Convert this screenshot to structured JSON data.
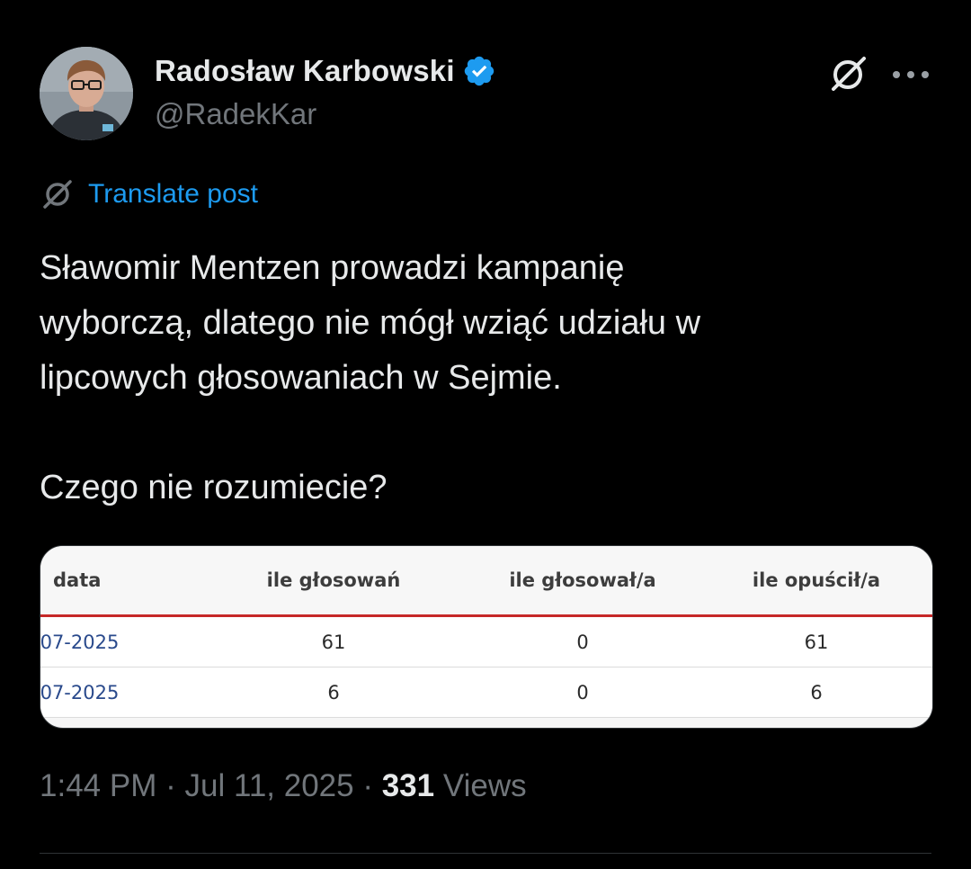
{
  "author": {
    "display_name": "Radosław Karbowski",
    "handle": "@RadekKar",
    "verified_badge_color": "#1d9bf0"
  },
  "actions": {
    "grok_icon": "grok-icon",
    "more_icon": "more-options-icon"
  },
  "translate": {
    "label": "Translate post",
    "color": "#1d9bf0"
  },
  "post": {
    "line1": "Sławomir Mentzen prowadzi kampanię",
    "line2": "wyborczą, dlatego nie mógł wziąć udziału w",
    "line3": "lipcowych głosowaniach w Sejmie.",
    "line4": "Czego nie rozumiecie?"
  },
  "media_table": {
    "headers": [
      "data",
      "ile głosowań",
      "ile głosował/a",
      "ile opuścił/a"
    ],
    "rows": [
      [
        "-07-2025",
        "61",
        "0",
        "61"
      ],
      [
        "-07-2025",
        "6",
        "0",
        "6"
      ]
    ],
    "accent_line_color": "#c62828",
    "date_link_color": "#2a4a8c"
  },
  "meta": {
    "time": "1:44 PM",
    "separator": "·",
    "date": "Jul 11, 2025",
    "views_count": "331",
    "views_label": "Views"
  }
}
